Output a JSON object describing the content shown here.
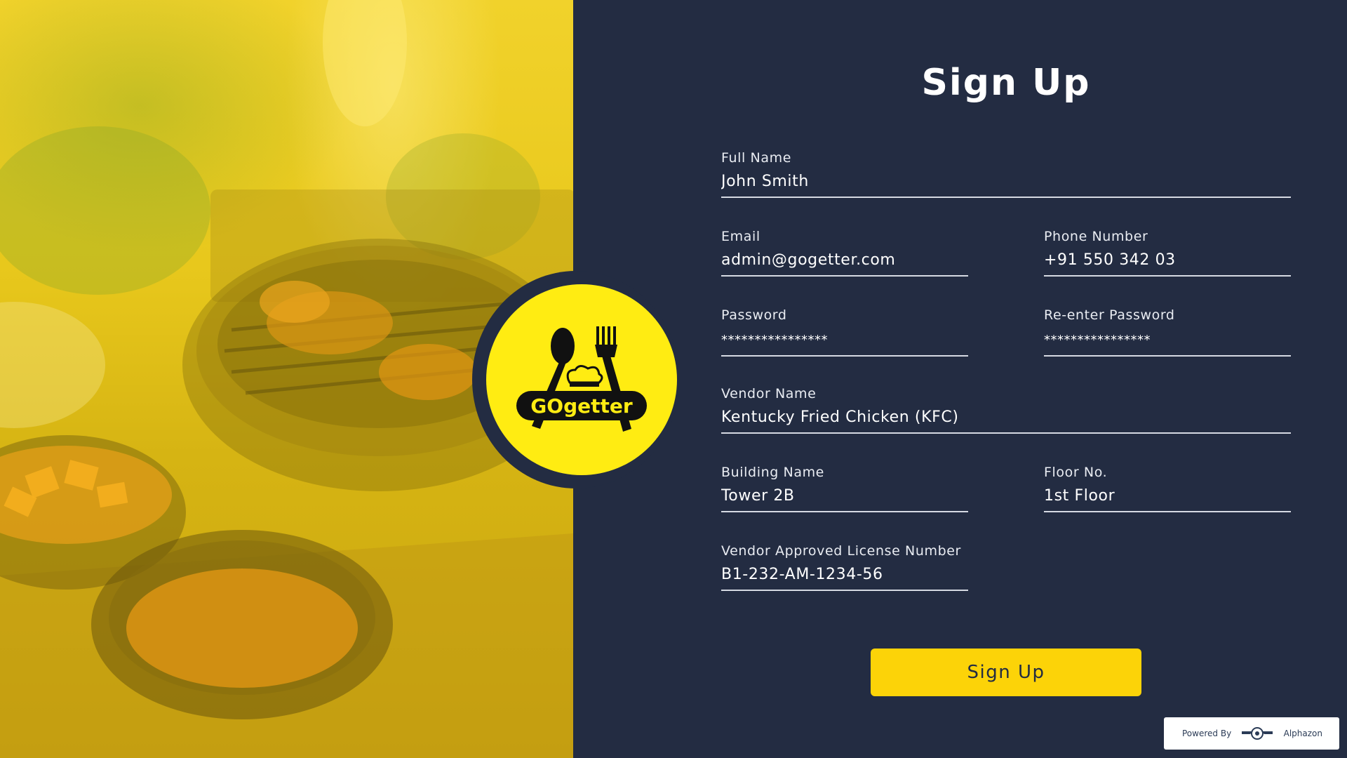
{
  "page": {
    "title": "Sign Up"
  },
  "brand": {
    "logo_text": "GOgetter",
    "accent": "#FCD308",
    "logo_yellow": "#FFEC12",
    "panel_bg": "#232C42"
  },
  "form": {
    "full_name": {
      "label": "Full Name",
      "value": "John Smith"
    },
    "email": {
      "label": "Email",
      "value": "admin@gogetter.com"
    },
    "phone": {
      "label": "Phone Number",
      "value": "+91 550 342 03"
    },
    "password": {
      "label": "Password",
      "value": "****************"
    },
    "reenter_password": {
      "label": "Re-enter Password",
      "value": "****************"
    },
    "vendor_name": {
      "label": "Vendor Name",
      "value": "Kentucky Fried Chicken (KFC)"
    },
    "building_name": {
      "label": "Building Name",
      "value": "Tower 2B"
    },
    "floor_no": {
      "label": "Floor No.",
      "value": "1st Floor"
    },
    "license": {
      "label": "Vendor Approved License Number",
      "value": "B1-232-AM-1234-56"
    },
    "submit_label": "Sign Up"
  },
  "footer": {
    "powered_by": "Powered By",
    "company": "Alphazon",
    "company_icon": "alphazon-wing-icon"
  }
}
